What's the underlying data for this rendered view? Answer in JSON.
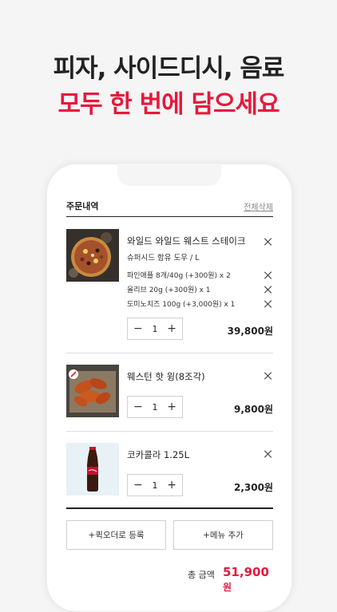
{
  "headline": {
    "line1": "피자, 사이드디시, 음료",
    "line2": "모두 한 번에 담으세요"
  },
  "orders": {
    "title": "주문내역",
    "delete_all": "전체삭제"
  },
  "items": [
    {
      "name": "와일드 와일드 웨스트 스테이크",
      "sub": "슈퍼시드 함유 도우 / L",
      "options": [
        "파인애플 8개/40g (+300원) x 2",
        "올리브 20g (+300원) x 1",
        "도미노치즈 100g (+3,000원) x 1"
      ],
      "qty": "1",
      "price": "39,800원"
    },
    {
      "name": "웨스턴 핫 윙(8조각)",
      "qty": "1",
      "price": "9,800원"
    },
    {
      "name": "코카콜라 1.25L",
      "qty": "1",
      "price": "2,300원"
    }
  ],
  "actions": {
    "quick_order": "+퀵오더로 등록",
    "add_menu": "+메뉴 추가"
  },
  "total": {
    "label": "총 금액",
    "value": "51,900",
    "unit": "원"
  },
  "colors": {
    "accent": "#e6193b",
    "text": "#222222"
  }
}
